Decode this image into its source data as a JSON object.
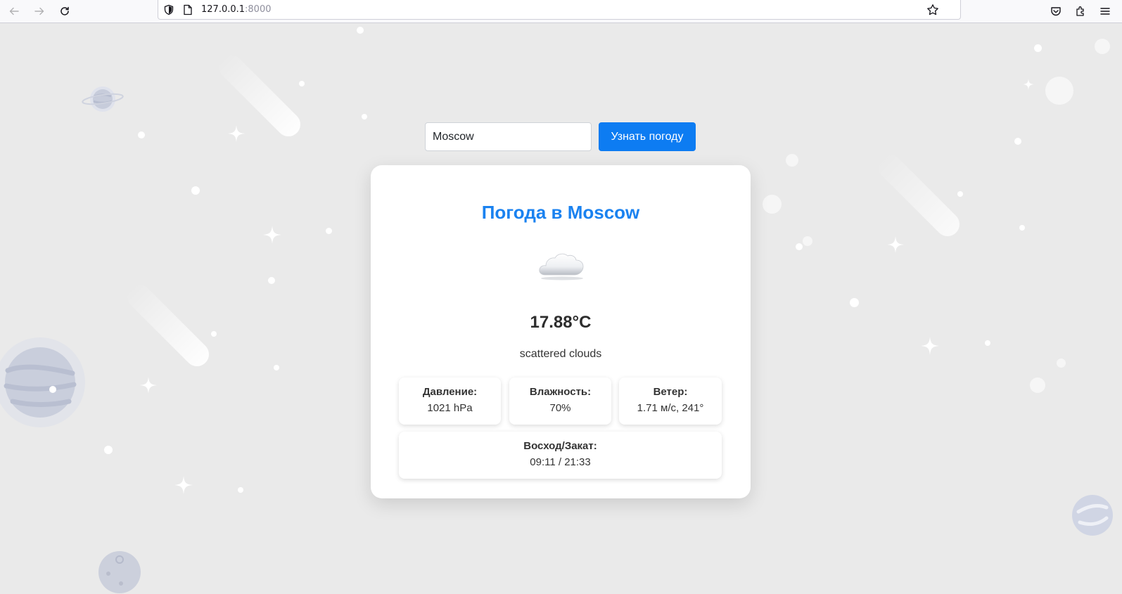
{
  "browser": {
    "url_host": "127.0.0.1",
    "url_port": ":8000",
    "icons": [
      "back-icon",
      "forward-icon",
      "reload-icon",
      "shield-icon",
      "page-icon",
      "bookmark-star-icon",
      "pocket-icon",
      "extensions-icon",
      "menu-icon"
    ]
  },
  "search": {
    "value": "Moscow",
    "button_label": "Узнать погоду"
  },
  "weather": {
    "title": "Погода в Moscow",
    "icon": "scattered-clouds-icon",
    "temperature": "17.88°C",
    "description": "scattered clouds",
    "pressure_label": "Давление:",
    "pressure_value": "1021 hPa",
    "humidity_label": "Влажность:",
    "humidity_value": "70%",
    "wind_label": "Ветер:",
    "wind_value": "1.71 м/с, 241°",
    "sun_label": "Восход/Закат:",
    "sun_value": "09:11 / 21:33"
  },
  "colors": {
    "accent": "#0d7cf2",
    "title": "#1a82f0",
    "background": "#eaeaea"
  }
}
